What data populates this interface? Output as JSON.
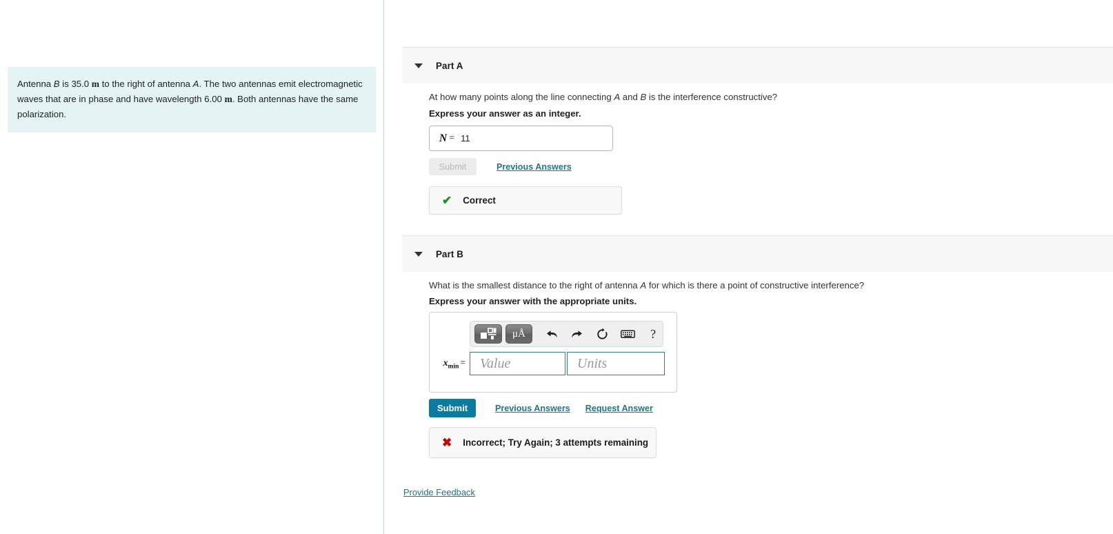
{
  "problem": {
    "text_part1": "Antenna ",
    "antenna_b": "B",
    "text_part2": " is 35.0 ",
    "unit_m_1": "m",
    "text_part3": " to the right of antenna ",
    "antenna_a": "A",
    "text_part4": ". The two antennas emit electromagnetic waves that are in phase and have wavelength 6.00 ",
    "unit_m_2": "m",
    "text_part5": ". Both antennas have the same polarization.",
    "full_text": "Antenna B is 35.0 m to the right of antenna A. The two antennas emit electromagnetic waves that are in phase and have wavelength 6.00 m. Both antennas have the same polarization."
  },
  "partA": {
    "title": "Part A",
    "caret_icon": "caret-down-icon",
    "question": "At how many points along the line connecting A and B is the interference constructive?",
    "instruction": "Express your answer as an integer.",
    "answer_variable": "N",
    "answer_equals": "=",
    "answer_value": "11",
    "submit_label": "Submit",
    "previous_answers_label": "Previous Answers",
    "feedback_icon": "check-icon",
    "feedback_text": "Correct",
    "feedback_color": "#109618"
  },
  "partB": {
    "title": "Part B",
    "caret_icon": "caret-down-icon",
    "question": "What is the smallest distance to the right of antenna A for which is there a point of constructive interference?",
    "instruction": "Express your answer with the appropriate units.",
    "answer_variable": "x",
    "answer_subscript": "min",
    "answer_equals": "=",
    "value_placeholder": "Value",
    "units_placeholder": "Units",
    "submit_label": "Submit",
    "previous_answers_label": "Previous Answers",
    "request_answer_label": "Request Answer",
    "feedback_icon": "cross-icon",
    "feedback_text": "Incorrect; Try Again; 3 attempts remaining",
    "feedback_color": "#cc0000",
    "toolbar": {
      "template_button": "template-icon",
      "units_button": "μÅ",
      "undo_icon": "undo-arrow-icon",
      "redo_icon": "redo-arrow-icon",
      "reset_icon": "reset-circular-arrow-icon",
      "keyboard_icon": "keyboard-icon",
      "help_icon": "?"
    }
  },
  "footer": {
    "provide_feedback_label": "Provide Feedback"
  },
  "colors": {
    "info_box_bg": "#e4f3f3",
    "part_header_bg": "#f7f7f8",
    "link": "#17788f",
    "submit_active": "#0c7b9e",
    "field_border": "#2d7c93",
    "correct": "#109618",
    "incorrect": "#cc0000"
  }
}
